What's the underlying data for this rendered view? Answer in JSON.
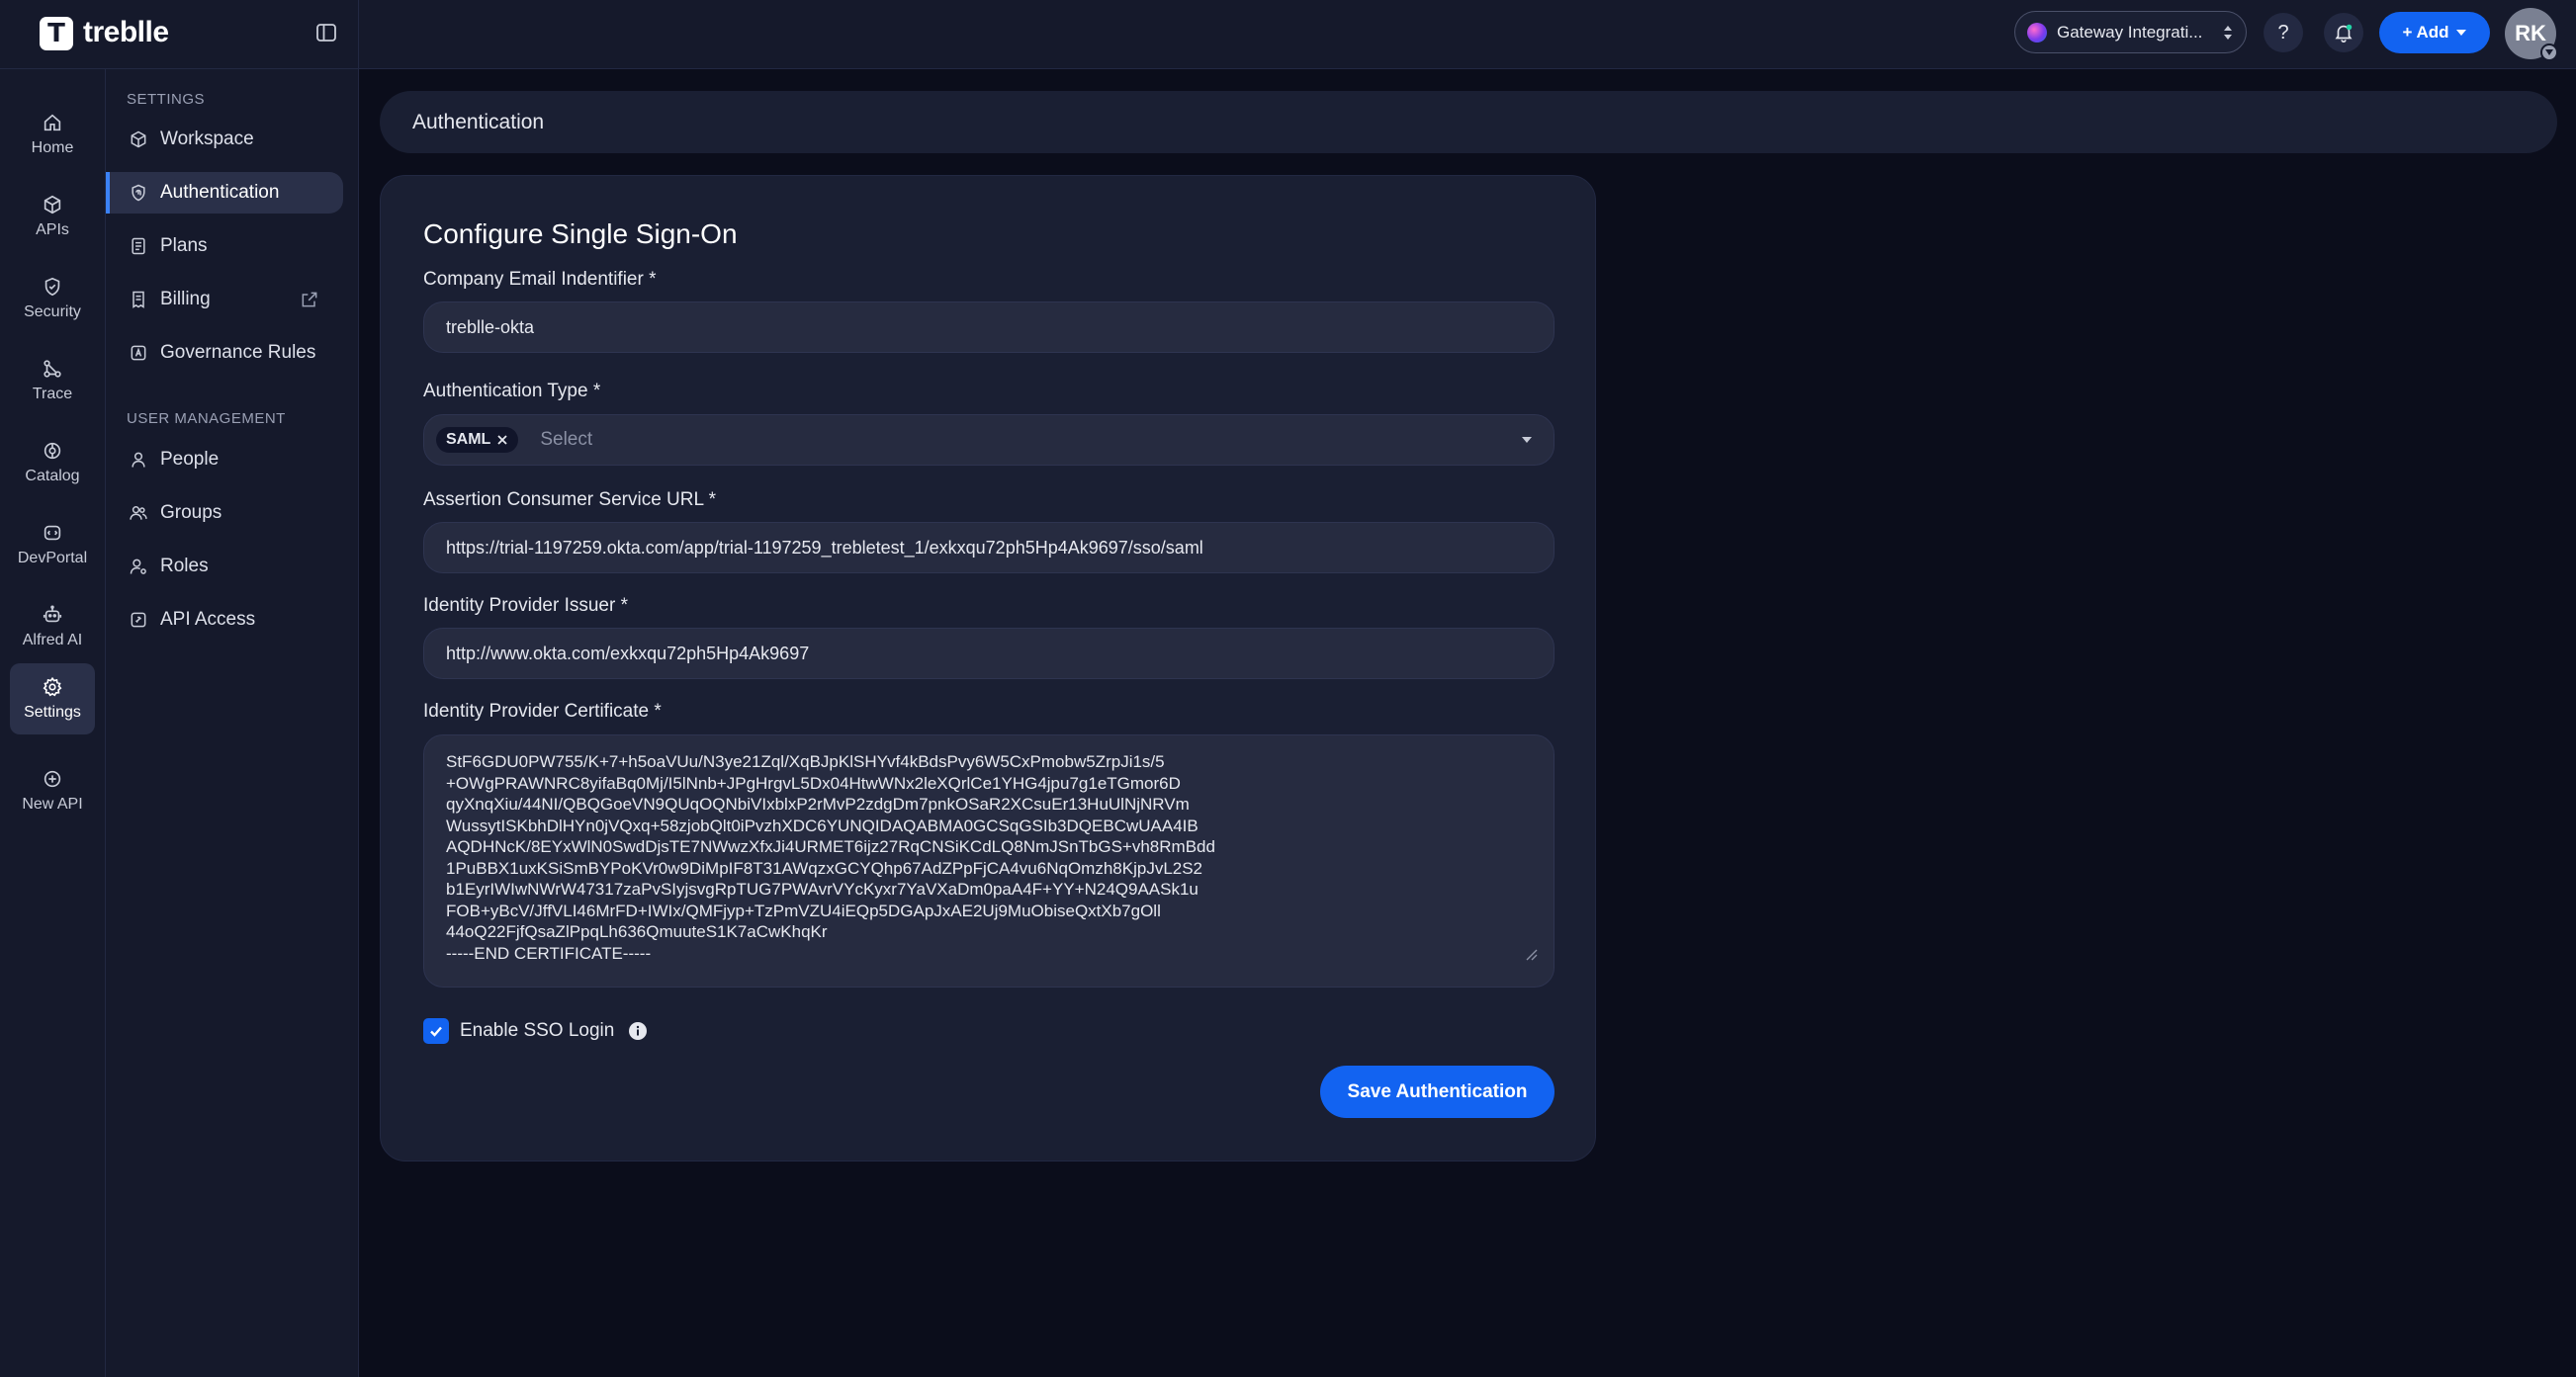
{
  "brand": {
    "name": "treblle",
    "logo_letter": "T"
  },
  "topbar": {
    "gateway_label": "Gateway Integrati...",
    "help_label": "?",
    "add_label": "+ Add",
    "avatar_initials": "RK"
  },
  "rail": {
    "items": [
      {
        "label": "Home",
        "icon": "home-icon"
      },
      {
        "label": "APIs",
        "icon": "cube-icon"
      },
      {
        "label": "Security",
        "icon": "shield-icon"
      },
      {
        "label": "Trace",
        "icon": "trace-icon"
      },
      {
        "label": "Catalog",
        "icon": "catalog-icon"
      },
      {
        "label": "DevPortal",
        "icon": "devportal-icon"
      },
      {
        "label": "Alfred AI",
        "icon": "robot-icon"
      },
      {
        "label": "Settings",
        "icon": "gear-icon",
        "active": true
      },
      {
        "label": "New API",
        "icon": "plus-circle-icon"
      }
    ]
  },
  "settings_nav": {
    "section_settings": "SETTINGS",
    "section_user_management": "USER MANAGEMENT",
    "items": [
      {
        "label": "Workspace",
        "icon": "workspace-icon"
      },
      {
        "label": "Authentication",
        "icon": "fingerprint-icon",
        "active": true
      },
      {
        "label": "Plans",
        "icon": "plans-icon"
      },
      {
        "label": "Billing",
        "icon": "billing-icon"
      },
      {
        "label": "Governance Rules",
        "icon": "governance-icon"
      },
      {
        "label": "People",
        "icon": "person-icon"
      },
      {
        "label": "Groups",
        "icon": "group-icon"
      },
      {
        "label": "Roles",
        "icon": "roles-icon"
      },
      {
        "label": "API Access",
        "icon": "api-access-icon"
      }
    ]
  },
  "page": {
    "header_title": "Authentication",
    "card_title": "Configure Single Sign-On"
  },
  "form": {
    "company_email_label": "Company Email Indentifier *",
    "company_email_value": "treblle-okta",
    "auth_type_label": "Authentication Type *",
    "auth_type_chip": "SAML",
    "auth_type_placeholder": "Select",
    "acs_url_label": "Assertion Consumer Service URL *",
    "acs_url_value": "https://trial-1197259.okta.com/app/trial-1197259_trebletest_1/exkxqu72ph5Hp4Ak9697/sso/saml",
    "idp_issuer_label": "Identity Provider Issuer *",
    "idp_issuer_value": "http://www.okta.com/exkxqu72ph5Hp4Ak9697",
    "idp_cert_label": "Identity Provider Certificate *",
    "idp_cert_value": "StF6GDU0PW755/K+7+h5oaVUu/N3ye21Zql/XqBJpKlSHYvf4kBdsPvy6W5CxPmobw5ZrpJi1s/5\n+OWgPRAWNRC8yifaBq0Mj/I5lNnb+JPgHrgvL5Dx04HtwWNx2leXQrlCe1YHG4jpu7g1eTGmor6D\nqyXnqXiu/44NI/QBQGoeVN9QUqOQNbiVIxblxP2rMvP2zdgDm7pnkOSaR2XCsuEr13HuUlNjNRVm\nWussytISKbhDlHYn0jVQxq+58zjobQlt0iPvzhXDC6YUNQIDAQABMA0GCSqGSIb3DQEBCwUAA4IB\nAQDHNcK/8EYxWlN0SwdDjsTE7NWwzXfxJi4URMET6ijz27RqCNSiKCdLQ8NmJSnTbGS+vh8RmBdd\n1PuBBX1uxKSiSmBYPoKVr0w9DiMpIF8T31AWqzxGCYQhp67AdZPpFjCA4vu6NqOmzh8KjpJvL2S2\nb1EyrIWIwNWrW47317zaPvSIyjsvgRpTUG7PWAvrVYcKyxr7YaVXaDm0paA4F+YY+N24Q9AASk1u\nFOB+yBcV/JffVLI46MrFD+IWIx/QMFjyp+TzPmVZU4iEQp5DGApJxAE2Uj9MuObiseQxtXb7gOll\n44oQ22FjfQsaZlPpqLh636QmuuteS1K7aCwKhqKr\n-----END CERTIFICATE-----",
    "enable_sso_label": "Enable SSO Login",
    "save_label": "Save Authentication"
  },
  "colors": {
    "accent": "#1263f1",
    "background": "#0b0d1b",
    "panel": "#15192b",
    "card": "#1a1f33",
    "input": "#262b40"
  }
}
